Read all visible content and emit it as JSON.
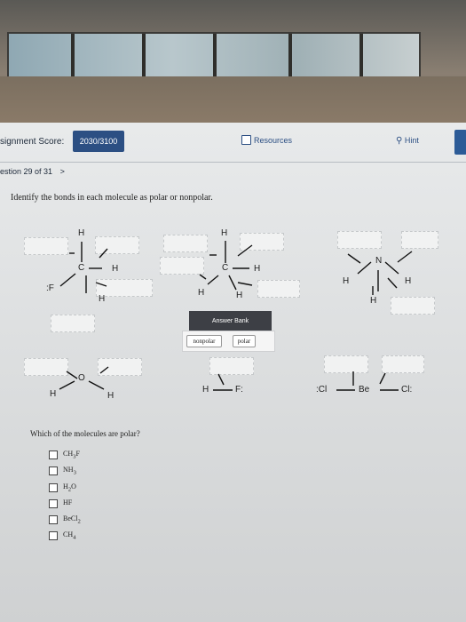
{
  "header": {
    "score_label": "signment Score:",
    "score_value": "2030/3100",
    "resources_label": "Resources",
    "hint_label": "Hint"
  },
  "question": {
    "number": "estion 29 of 31",
    "nav_arrow": ">",
    "instruction": "Identify the bonds in each molecule as polar or nonpolar.",
    "polar_question": "Which of the molecules are polar?"
  },
  "molecules": {
    "ch3f": {
      "h_top": "H",
      "c": "C",
      "h_right": "H",
      "h_bottom": "H",
      "f": "F"
    },
    "ch4": {
      "h_top": "H",
      "c": "C",
      "h_right": "H",
      "h_left": "H",
      "h_bottom": "H"
    },
    "nh3": {
      "n": "N",
      "h_left": "H",
      "h_right": "H",
      "h_bottom": "H"
    },
    "h2o": {
      "o": "O",
      "h_left": "H",
      "h_right": "H"
    },
    "hf": {
      "h": "H",
      "f": "F"
    },
    "becl2": {
      "cl_left": "Cl",
      "be": "Be",
      "cl_right": "Cl"
    }
  },
  "answer_bank": {
    "title": "Answer Bank",
    "options": [
      "nonpolar",
      "polar"
    ]
  },
  "choices": [
    {
      "main": "CH",
      "sub": "3",
      "tail": "F"
    },
    {
      "main": "NH",
      "sub": "3",
      "tail": ""
    },
    {
      "main": "H",
      "sub": "2",
      "tail": "O"
    },
    {
      "main": "HF",
      "sub": "",
      "tail": ""
    },
    {
      "main": "BeCl",
      "sub": "2",
      "tail": ""
    },
    {
      "main": "CH",
      "sub": "4",
      "tail": ""
    }
  ]
}
